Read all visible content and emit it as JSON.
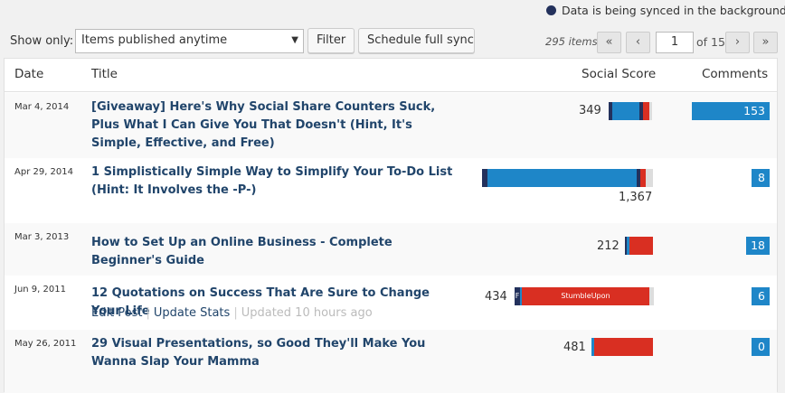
{
  "sync_status": {
    "text": "Data is being synced in the background",
    "color": "#23315c"
  },
  "toolbar": {
    "show_only_label": "Show only:",
    "filter_select_value": "Items published anytime",
    "filter_label": "Filter",
    "schedule_label": "Schedule full sync"
  },
  "pagination": {
    "items_count": "295 items",
    "first": "«",
    "prev": "‹",
    "current_page": "1",
    "of_total": "of 15",
    "next": "›",
    "last": "»"
  },
  "columns": {
    "date": "Date",
    "title": "Title",
    "social_score": "Social Score",
    "comments": "Comments"
  },
  "colors": {
    "facebook": "#23315c",
    "twitter": "#1e86c8",
    "stumbleupon": "#d92f22",
    "other": "#dddddd"
  },
  "rows": [
    {
      "date": "Mar 4, 2014",
      "title": "[Giveaway] Here's Why Social Share Counters Suck, Plus What I Can Give You That Doesn't (Hint, It's Simple, Effective, and Free)",
      "score": "349",
      "comments": "153"
    },
    {
      "date": "Apr 29, 2014",
      "title": "1 Simplistically Simple Way to Simplify Your To-Do List (Hint: It Involves the -P-)",
      "score": "1,367",
      "comments": "8"
    },
    {
      "date": "Mar 3, 2013",
      "title": "How to Set Up an Online Business - Complete Beginner's Guide",
      "score": "212",
      "comments": "18"
    },
    {
      "date": "Jun 9, 2011",
      "title": "12 Quotations on Success That Are Sure to Change Your Life",
      "score": "434",
      "comments": "6",
      "segment_label_f": "F",
      "segment_label_su": "StumbleUpon",
      "actions": {
        "edit": "Edit Post",
        "update": "Update Stats",
        "updated": "Updated 10 hours ago"
      }
    },
    {
      "date": "May 26, 2011",
      "title": "29 Visual Presentations, so Good They'll Make You Wanna Slap Your Mamma",
      "score": "481",
      "comments": "0"
    }
  ]
}
